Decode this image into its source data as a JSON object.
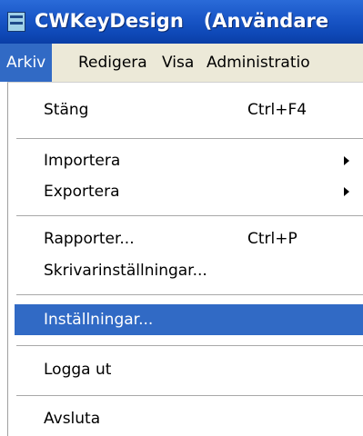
{
  "window": {
    "title": "CWKeyDesign   (Användare",
    "icon": "app-window-icon"
  },
  "menubar": {
    "items": [
      "Arkiv",
      "Redigera",
      "Visa",
      "Administratio"
    ],
    "active": "Arkiv"
  },
  "dropdown": {
    "items": [
      {
        "label": "Stäng",
        "shortcut": "Ctrl+F4"
      },
      {
        "label": "Importera",
        "submenu": true
      },
      {
        "label": "Exportera",
        "submenu": true
      },
      {
        "label": "Rapporter...",
        "shortcut": "Ctrl+P"
      },
      {
        "label": "Skrivarinställningar..."
      },
      {
        "label": "Inställningar...",
        "highlighted": true
      },
      {
        "label": "Logga ut"
      },
      {
        "label": "Avsluta"
      }
    ]
  },
  "colors": {
    "titlebar": "#1a57c8",
    "menubar": "#ece9d8",
    "highlight": "#316ac5",
    "highlight_text": "#ffffff"
  }
}
